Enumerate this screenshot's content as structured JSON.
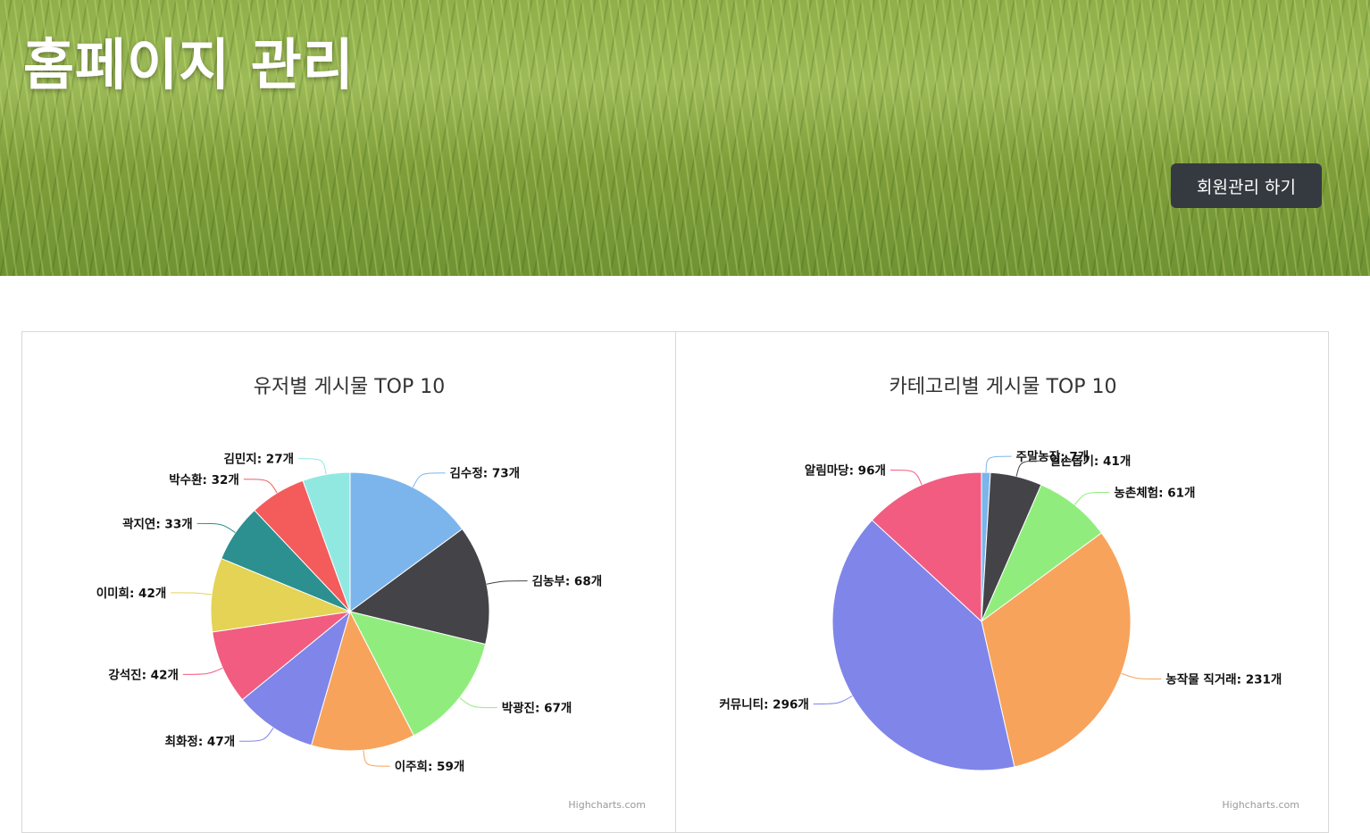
{
  "header": {
    "title": "홈페이지 관리",
    "member_button": "회원관리 하기"
  },
  "credit": "Highcharts.com",
  "chart_data": [
    {
      "type": "pie",
      "title": "유저별 게시물 TOP 10",
      "unit": "개",
      "slices": [
        {
          "name": "김수정",
          "value": 73,
          "color": "#7cb5ec"
        },
        {
          "name": "김농부",
          "value": 68,
          "color": "#434348"
        },
        {
          "name": "박광진",
          "value": 67,
          "color": "#90ed7d"
        },
        {
          "name": "이주희",
          "value": 59,
          "color": "#f7a35c"
        },
        {
          "name": "최화정",
          "value": 47,
          "color": "#8085e9"
        },
        {
          "name": "강석진",
          "value": 42,
          "color": "#f15c80"
        },
        {
          "name": "이미희",
          "value": 42,
          "color": "#e4d354"
        },
        {
          "name": "곽지연",
          "value": 33,
          "color": "#2b908f"
        },
        {
          "name": "박수환",
          "value": 32,
          "color": "#f45b5b"
        },
        {
          "name": "김민지",
          "value": 27,
          "color": "#91e8e1"
        }
      ]
    },
    {
      "type": "pie",
      "title": "카테고리별 게시물 TOP 10",
      "unit": "개",
      "slices": [
        {
          "name": "주말농장",
          "value": 7,
          "color": "#7cb5ec"
        },
        {
          "name": "일손돕기",
          "value": 41,
          "color": "#434348"
        },
        {
          "name": "농촌체험",
          "value": 61,
          "color": "#90ed7d"
        },
        {
          "name": "농작물 직거래",
          "value": 231,
          "color": "#f7a35c"
        },
        {
          "name": "커뮤니티",
          "value": 296,
          "color": "#8085e9"
        },
        {
          "name": "알림마당",
          "value": 96,
          "color": "#f15c80"
        }
      ]
    }
  ]
}
